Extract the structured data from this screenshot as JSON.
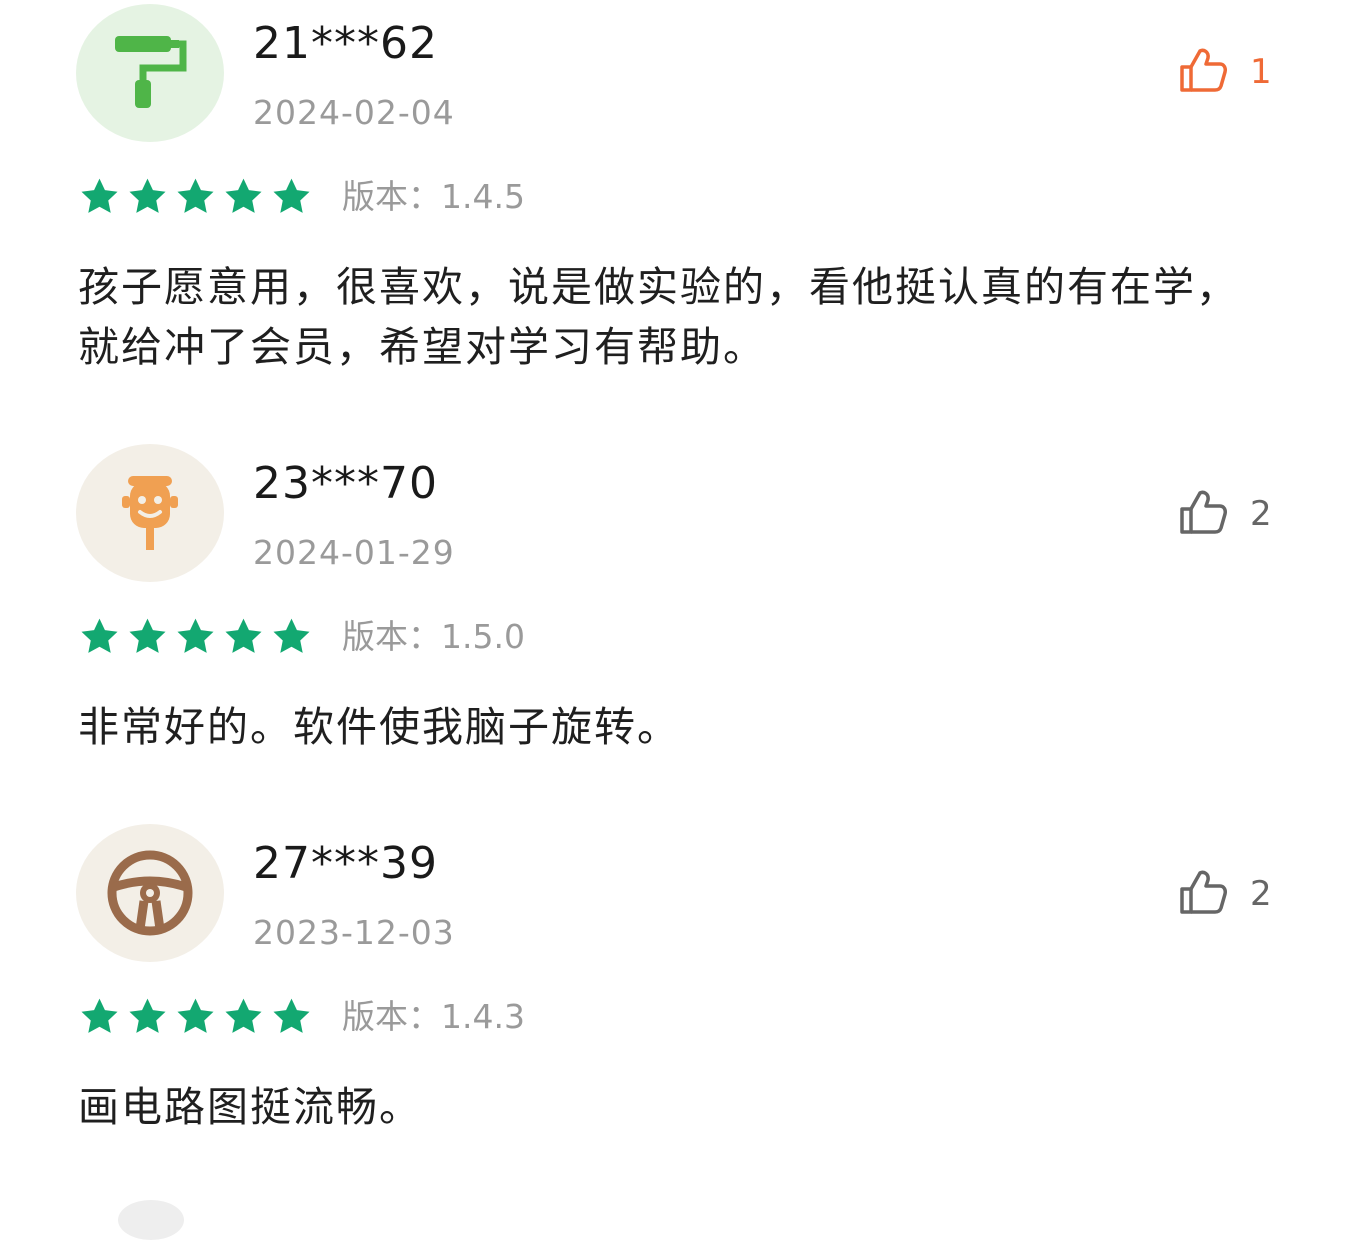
{
  "colors": {
    "star": "#13a871",
    "like_active": "#ef6a36",
    "like_inactive": "#666666"
  },
  "reviews": [
    {
      "username": "21***62",
      "date": "2024-02-04",
      "likes": "1",
      "liked": true,
      "rating": 5,
      "version": "版本：1.4.5",
      "content": "孩子愿意用，很喜欢，说是做实验的，看他挺认真的有在学，就给冲了会员，希望对学习有帮助。",
      "avatar_icon": "paint-roller-icon",
      "avatar_bg": "#e5f3e3"
    },
    {
      "username": "23***70",
      "date": "2024-01-29",
      "likes": "2",
      "liked": false,
      "rating": 5,
      "version": "版本：1.5.0",
      "content": "非常好的。软件使我脑子旋转。",
      "avatar_icon": "face-on-stick-icon",
      "avatar_bg": "#f3efe7"
    },
    {
      "username": "27***39",
      "date": "2023-12-03",
      "likes": "2",
      "liked": false,
      "rating": 5,
      "version": "版本：1.4.3",
      "content": "画电路图挺流畅。",
      "avatar_icon": "steering-wheel-icon",
      "avatar_bg": "#f3efe7"
    }
  ]
}
